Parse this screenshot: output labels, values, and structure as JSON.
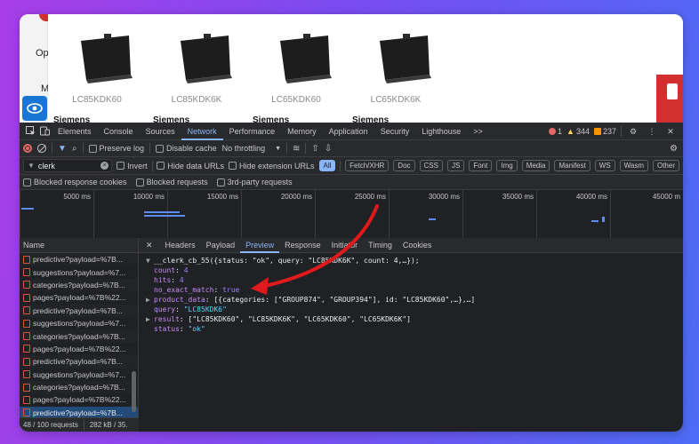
{
  "webpage": {
    "top_left_text": "Op",
    "mid_left_text": "M",
    "products": [
      {
        "sku": "LC85KDK60",
        "brand": "Siemens"
      },
      {
        "sku": "LC85KDK6K",
        "brand": "Siemens"
      },
      {
        "sku": "LC65KDK60",
        "brand": "Siemens"
      },
      {
        "sku": "LC65KDK6K",
        "brand": "Siemens"
      }
    ],
    "colors": {
      "accent_red": "#d32f2f",
      "accessibility_blue": "#1976d2"
    }
  },
  "devtools": {
    "tabs": [
      "Elements",
      "Console",
      "Sources",
      "Network",
      "Performance",
      "Memory",
      "Application",
      "Security",
      "Lighthouse"
    ],
    "active_tab": "Network",
    "more_tabs": ">>",
    "errors": "1",
    "warnings": "344",
    "issues": "237",
    "options": {
      "preserve_log": "Preserve log",
      "disable_cache": "Disable cache",
      "throttling": "No throttling"
    },
    "filter": {
      "value": "clerk",
      "invert": "Invert",
      "hide_data_urls": "Hide data URLs",
      "hide_extension_urls": "Hide extension URLs",
      "types": [
        "All",
        "Fetch/XHR",
        "Doc",
        "CSS",
        "JS",
        "Font",
        "Img",
        "Media",
        "Manifest",
        "WS",
        "Wasm",
        "Other"
      ],
      "active_type": "All"
    },
    "blocked": {
      "response_cookies": "Blocked response cookies",
      "requests": "Blocked requests",
      "third_party": "3rd-party requests"
    },
    "timeline_ticks": [
      "5000 ms",
      "10000 ms",
      "15000 ms",
      "20000 ms",
      "25000 ms",
      "30000 ms",
      "35000 ms",
      "40000 ms",
      "45000 m"
    ],
    "name_column": "Name",
    "requests": [
      "predictive?payload=%7B...",
      "suggestions?payload=%7...",
      "categories?payload=%7B...",
      "pages?payload=%7B%22...",
      "predictive?payload=%7B...",
      "suggestions?payload=%7...",
      "categories?payload=%7B...",
      "pages?payload=%7B%22...",
      "predictive?payload=%7B...",
      "suggestions?payload=%7...",
      "categories?payload=%7B...",
      "pages?payload=%7B%22...",
      "predictive?payload=%7B..."
    ],
    "selected_request_index": 12,
    "status": {
      "requests": "48 / 100 requests",
      "size": "282 kB / 35."
    },
    "detail_tabs": [
      "Headers",
      "Payload",
      "Preview",
      "Response",
      "Initiator",
      "Timing",
      "Cookies"
    ],
    "active_detail_tab": "Preview",
    "preview": {
      "root": "__clerk_cb_55({status: \"ok\", query: \"LC85KDK6K\", count: 4,…});",
      "count_key": "count",
      "count_val": "4",
      "hits_key": "hits",
      "hits_val": "4",
      "no_exact_key": "no_exact_match",
      "no_exact_val": "true",
      "product_data_key": "product_data",
      "product_data_val": "[{categories: [\"GROUP874\", \"GROUP394\"], id: \"LC85KDK60\",…},…]",
      "query_key": "query",
      "query_val": "\"LC85KDK6\"",
      "result_key": "result",
      "result_val": "[\"LC85KDK60\", \"LC85KDK6K\", \"LC65KDK60\", \"LC65KDK6K\"]",
      "status_key": "status",
      "status_val": "\"ok\""
    },
    "colors": {
      "active_blue": "#8ab4f8",
      "selected_row": "#234b7a",
      "annotation_red": "#e0191c"
    }
  }
}
